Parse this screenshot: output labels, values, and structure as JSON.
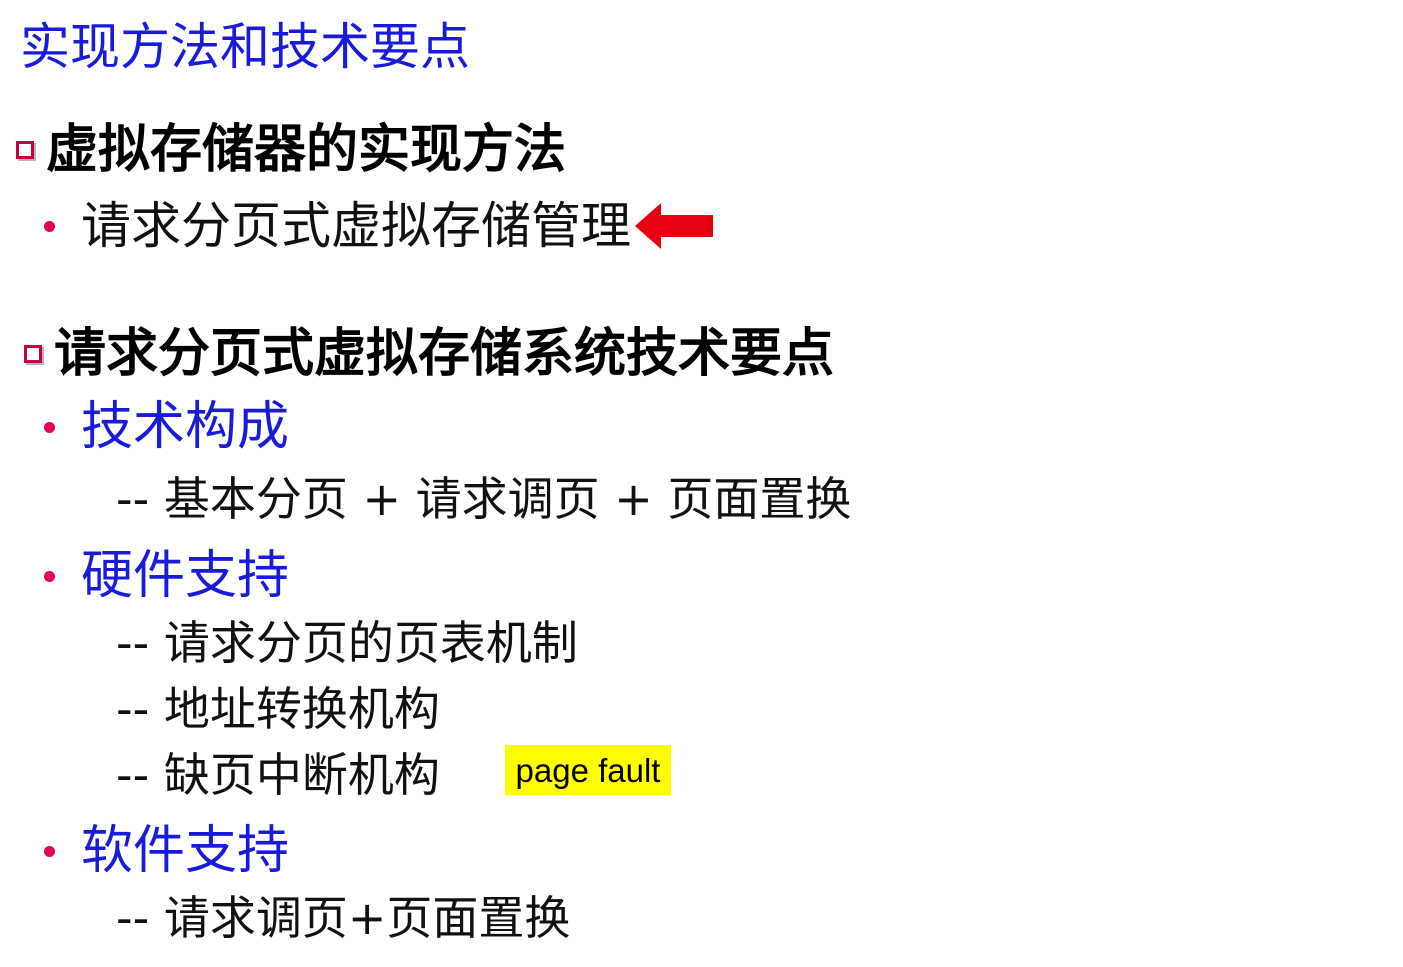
{
  "title": "实现方法和技术要点",
  "section1": {
    "heading": "虚拟存储器的实现方法",
    "bullet": "请求分页式虚拟存储管理"
  },
  "section2": {
    "heading": "请求分页式虚拟存储系统技术要点",
    "items": [
      {
        "label": "技术构成",
        "subs": [
          "-- 基本分页 + 请求调页 + 页面置换"
        ]
      },
      {
        "label": "硬件支持",
        "subs": [
          "-- 请求分页的页表机制",
          "-- 地址转换机构",
          "-- 缺页中断机构"
        ]
      },
      {
        "label": "软件支持",
        "subs": [
          "-- 请求调页+页面置换"
        ]
      }
    ]
  },
  "note": "page fault",
  "colors": {
    "title": "#1a1adb",
    "bullet_dot": "#e5005b",
    "checkbox": "#c8003c",
    "arrow": "#e60012",
    "highlight": "#ffff00"
  },
  "icons": {
    "section_marker": "checkbox-square-icon",
    "arrow": "left-arrow-icon"
  }
}
